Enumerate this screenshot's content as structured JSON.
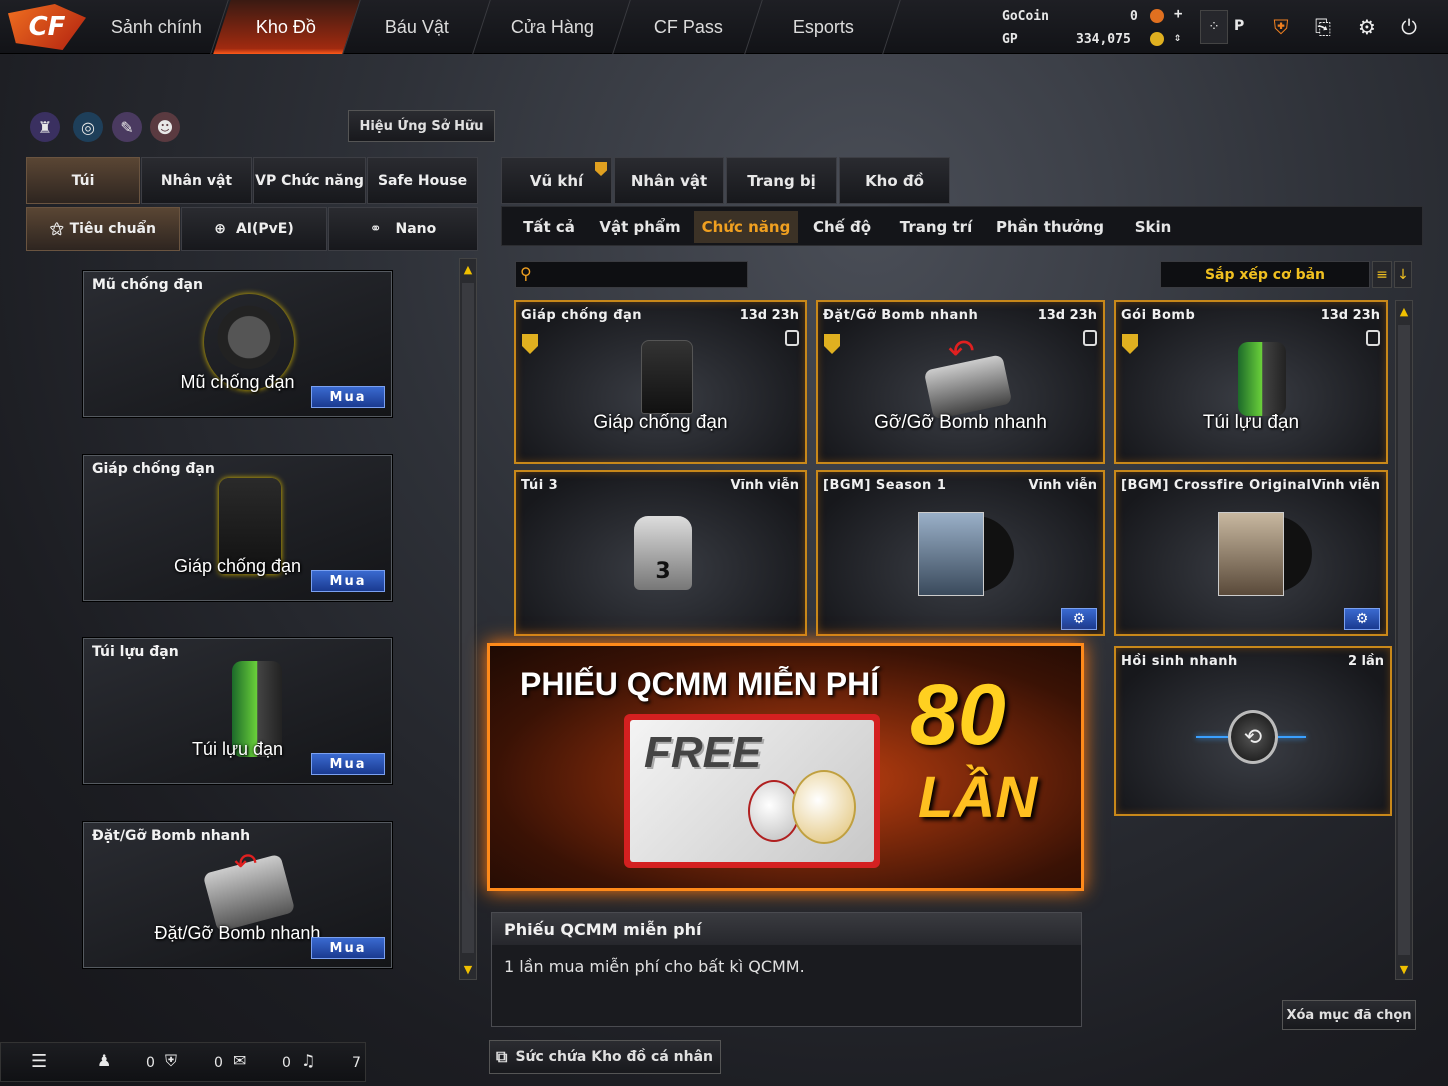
{
  "topnav": {
    "tabs": [
      "Sảnh chính",
      "Kho Đồ",
      "Báu Vật",
      "Cửa Hàng",
      "CF Pass",
      "Esports"
    ],
    "active": 1
  },
  "currency": {
    "gocoin_label": "GoCoin",
    "gocoin_value": "0",
    "gp_label": "GP",
    "gp_value": "334,075",
    "p_label": "P"
  },
  "owned_effects_label": "Hiệu Ứng Sở Hữu",
  "left_tabs": [
    "Túi",
    "Nhân vật",
    "VP Chức năng",
    "Safe House"
  ],
  "mode_tabs": [
    "Tiêu chuẩn",
    "AI(PvE)",
    "Nano"
  ],
  "loadout": [
    {
      "name": "Mũ chống đạn",
      "caption": "Mũ chống đạn",
      "buy": "Mua"
    },
    {
      "name": "Giáp chống đạn",
      "caption": "Giáp chống đạn",
      "buy": "Mua"
    },
    {
      "name": "Túi lựu đạn",
      "caption": "Túi lựu đạn",
      "buy": "Mua"
    },
    {
      "name": "Đặt/Gỡ Bomb nhanh",
      "caption": "Đặt/Gỡ Bomb nhanh",
      "buy": "Mua"
    }
  ],
  "right_tabs": [
    "Vũ khí",
    "Nhân vật",
    "Trang bị",
    "Kho đồ"
  ],
  "sub_tabs": [
    "Tất cả",
    "Vật phẩm",
    "Chức năng",
    "Chế độ",
    "Trang trí",
    "Phần thưởng",
    "Skin"
  ],
  "sort_label": "Sắp xếp cơ bản",
  "search": {
    "placeholder": ""
  },
  "items": [
    {
      "name": "Giáp chống đạn",
      "time": "13d 23h",
      "caption": "Giáp chống đạn"
    },
    {
      "name": "Đặt/Gỡ Bomb nhanh",
      "time": "13d 23h",
      "caption": "Gỡ/Gỡ Bomb nhanh"
    },
    {
      "name": "Gói Bomb",
      "time": "13d 23h",
      "caption": "Túi lựu đạn"
    },
    {
      "name": "Túi 3",
      "time": "Vĩnh viễn",
      "caption": ""
    },
    {
      "name": "[BGM] Season 1",
      "time": "Vĩnh viễn",
      "caption": ""
    },
    {
      "name": "[BGM] Crossfire Original",
      "time": "Vĩnh viễn",
      "caption": ""
    },
    {
      "name": "Hồi sinh nhanh",
      "time": "2 lần",
      "caption": ""
    }
  ],
  "banner": {
    "title": "PHIẾU QCMM MIỄN PHÍ",
    "big_number": "80",
    "times": "LẦN",
    "free": "FREE"
  },
  "description": {
    "title": "Phiếu QCMM miễn phí",
    "text": "1 lần mua miễn phí cho bất kì QCMM."
  },
  "clear_selected": "Xóa mục đã chọn",
  "capacity_label": "Sức chứa Kho đồ cá nhân",
  "statusbar": {
    "v1": "0",
    "v2": "0",
    "v3": "0",
    "v4": "7"
  }
}
